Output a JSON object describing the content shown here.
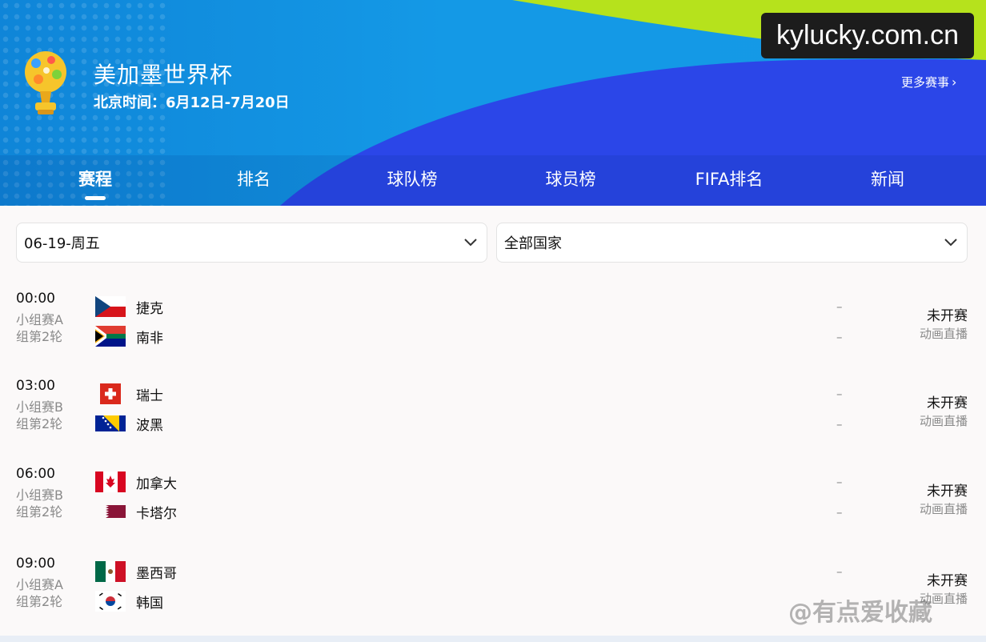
{
  "header": {
    "title": "美加墨世界杯",
    "subtitle": "北京时间：6月12日-7月20日",
    "watermark": "kylucky.com.cn",
    "more_label": "更多赛事",
    "more_chevron": "›"
  },
  "tabs": [
    {
      "label": "赛程",
      "active": true
    },
    {
      "label": "排名",
      "active": false
    },
    {
      "label": "球队榜",
      "active": false
    },
    {
      "label": "球员榜",
      "active": false
    },
    {
      "label": "FIFA排名",
      "active": false
    },
    {
      "label": "新闻",
      "active": false
    }
  ],
  "filters": {
    "date": "06-19-周五",
    "country": "全部国家"
  },
  "matches": [
    {
      "time": "00:00",
      "stage_line1": "小组赛A",
      "stage_line2": "组第2轮",
      "home": {
        "name": "捷克",
        "flag": "czech-flag-icon",
        "score": "–"
      },
      "away": {
        "name": "南非",
        "flag": "south-africa-flag-icon",
        "score": "–"
      },
      "status": "未开赛",
      "live": "动画直播"
    },
    {
      "time": "03:00",
      "stage_line1": "小组赛B",
      "stage_line2": "组第2轮",
      "home": {
        "name": "瑞士",
        "flag": "switzerland-flag-icon",
        "score": "–"
      },
      "away": {
        "name": "波黑",
        "flag": "bosnia-flag-icon",
        "score": "–"
      },
      "status": "未开赛",
      "live": "动画直播"
    },
    {
      "time": "06:00",
      "stage_line1": "小组赛B",
      "stage_line2": "组第2轮",
      "home": {
        "name": "加拿大",
        "flag": "canada-flag-icon",
        "score": "–"
      },
      "away": {
        "name": "卡塔尔",
        "flag": "qatar-flag-icon",
        "score": "–"
      },
      "status": "未开赛",
      "live": "动画直播"
    },
    {
      "time": "09:00",
      "stage_line1": "小组赛A",
      "stage_line2": "组第2轮",
      "home": {
        "name": "墨西哥",
        "flag": "mexico-flag-icon",
        "score": "–"
      },
      "away": {
        "name": "韩国",
        "flag": "south-korea-flag-icon",
        "score": "–"
      },
      "status": "未开赛",
      "live": "动画直播"
    }
  ],
  "footer_watermark": "@有点爱收藏",
  "colors": {
    "header_blue": "#1599e6",
    "header_deep_blue": "#2b46e8",
    "accent_lime": "#b6e21c"
  }
}
